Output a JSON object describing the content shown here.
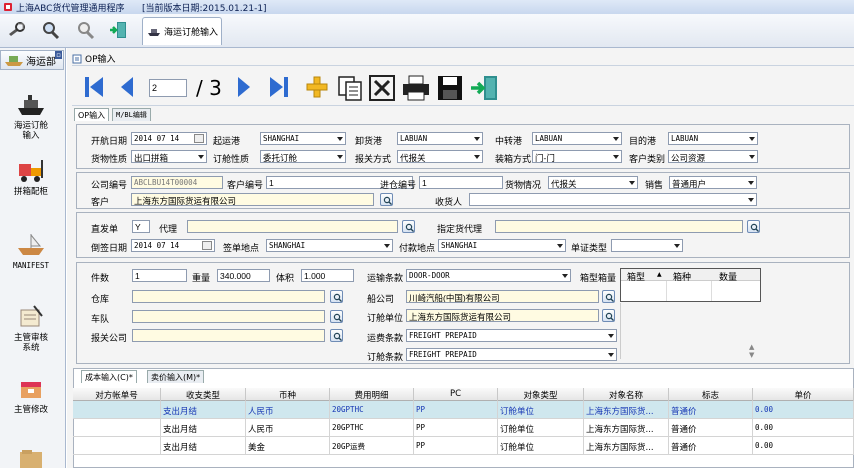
{
  "window": {
    "app_title": "上海ABC货代管理通用程序",
    "version_label": "[当前版本日期:2015.01.21-1]"
  },
  "doc_tab": {
    "label": "海运订舱输入"
  },
  "sidebar": {
    "header": "海运部",
    "items": [
      {
        "label": "海运订舱\n输入"
      },
      {
        "label": "拼箱配柜"
      },
      {
        "label": "MANIFEST"
      },
      {
        "label": "主管审核\n系统"
      },
      {
        "label": "主管修改"
      }
    ]
  },
  "op_title": "OP输入",
  "nav": {
    "page_current": "2",
    "page_total": "/ 3"
  },
  "inner_tabs": [
    "OP输入",
    "M/BL编辑"
  ],
  "form": {
    "kaihang_riqi": {
      "label": "开航日期",
      "value": "2014 07 14"
    },
    "qiyungang": {
      "label": "起运港",
      "value": "SHANGHAI"
    },
    "xiehuogang": {
      "label": "卸货港",
      "value": "LABUAN"
    },
    "zhongzhuangang": {
      "label": "中转港",
      "value": "LABUAN"
    },
    "mudigang": {
      "label": "目的港",
      "value": "LABUAN"
    },
    "huowu_xingzhi": {
      "label": "货物性质",
      "value": "出口拼箱"
    },
    "dingcang_xingzhi": {
      "label": "订舱性质",
      "value": "委托订舱"
    },
    "baoguan_fangshi": {
      "label": "报关方式",
      "value": "代报关"
    },
    "zhuangxiang_fangshi": {
      "label": "装箱方式",
      "value": "门-门"
    },
    "kehu_leibie": {
      "label": "客户类别",
      "value": "公司资源"
    },
    "gongsi_bianhao": {
      "label": "公司编号",
      "value": "ABCLBU14T00004"
    },
    "kehu_bianhao": {
      "label": "客户编号",
      "value": "1"
    },
    "jincang_bianhao": {
      "label": "进仓编号",
      "value": "1"
    },
    "huowu_qingkuang": {
      "label": "货物情况",
      "value": "代报关"
    },
    "xiaoshou": {
      "label": "销售",
      "value": "普通用户"
    },
    "kehu": {
      "label": "客户",
      "value": "上海东方国际货运有限公司"
    },
    "shouhuoren": {
      "label": "收货人",
      "value": ""
    },
    "zhifadan": {
      "label": "直发单",
      "value": "Y"
    },
    "daili": {
      "label": "代理",
      "value": ""
    },
    "zhiding_huodai": {
      "label": "指定货代理",
      "value": ""
    },
    "daoqian_riqi": {
      "label": "倒签日期",
      "value": "2014 07 14"
    },
    "qiandan_didian": {
      "label": "签单地点",
      "value": "SHANGHAI"
    },
    "fukuan_didian": {
      "label": "付款地点",
      "value": "SHANGHAI"
    },
    "danzheng_leixing": {
      "label": "单证类型",
      "value": ""
    },
    "jianshu": {
      "label": "件数",
      "value": "1"
    },
    "zhongliang": {
      "label": "重量",
      "value": "340.000"
    },
    "tiji": {
      "label": "体积",
      "value": "1.000"
    },
    "cangku": {
      "label": "仓库",
      "value": ""
    },
    "chedui": {
      "label": "车队",
      "value": ""
    },
    "baoguan_gongsi": {
      "label": "报关公司",
      "value": ""
    },
    "yunshu_tiaokuan": {
      "label": "运输条款",
      "value": "DOOR-DOOR"
    },
    "xiangxing_xiangliang": {
      "label": "箱型箱量",
      "value": ""
    },
    "chuangongsi": {
      "label": "船公司",
      "value": "川崎汽船(中国)有限公司"
    },
    "dingcang_danwei": {
      "label": "订舱单位",
      "value": "上海东方国际货运有限公司"
    },
    "yunfei_tiaokuan": {
      "label": "运费条款",
      "value": "FREIGHT PREPAID"
    },
    "dingcang_tiaokuan": {
      "label": "订舱条款",
      "value": "FREIGHT PREPAID"
    }
  },
  "box_table": {
    "headers": [
      "箱型",
      "箱种",
      "数量"
    ]
  },
  "grid": {
    "tabs": [
      "成本输入(C)*",
      "卖价输入(M)*"
    ],
    "headers": [
      "对方帐单号",
      "收支类型",
      "币种",
      "费用明细",
      "PC",
      "对象类型",
      "对象名称",
      "标志",
      "单价"
    ],
    "rows": [
      [
        "",
        "支出月结",
        "人民币",
        "20GPTHC",
        "PP",
        "订舱单位",
        "上海东方国际货...",
        "普通价",
        "0.00"
      ],
      [
        "",
        "支出月结",
        "人民币",
        "20GPTHC",
        "PP",
        "订舱单位",
        "上海东方国际货...",
        "普通价",
        "0.00"
      ],
      [
        "",
        "支出月结",
        "美金",
        "20GP运费",
        "PP",
        "订舱单位",
        "上海东方国际货...",
        "普通价",
        "0.00"
      ]
    ]
  }
}
